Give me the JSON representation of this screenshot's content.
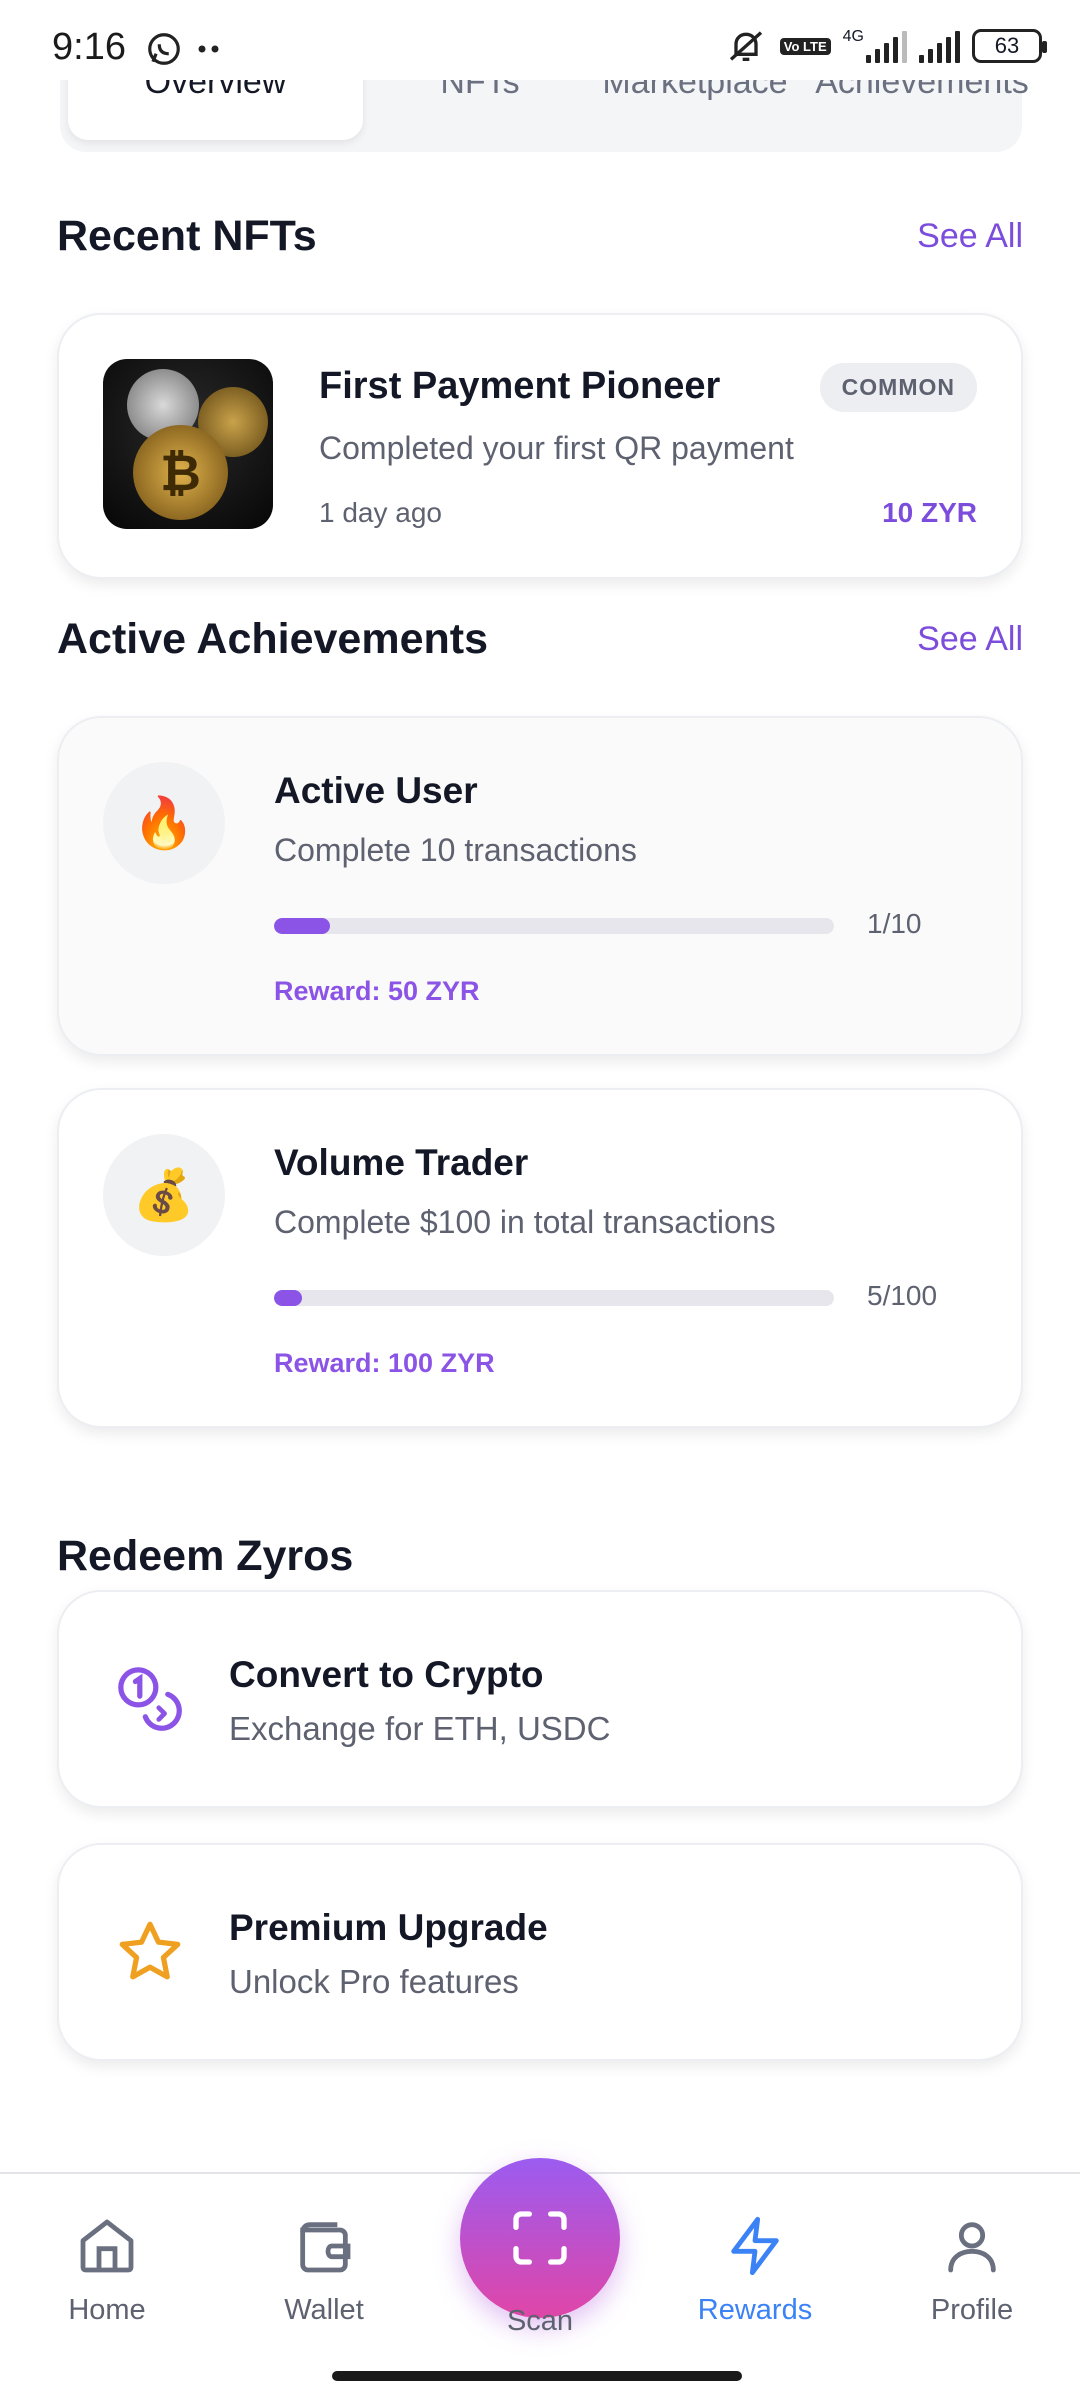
{
  "status_bar": {
    "time": "9:16",
    "network": "4G",
    "lte_label": "Vo LTE",
    "battery": "63"
  },
  "tabs": [
    {
      "label": "Overview",
      "active": true
    },
    {
      "label": "NFTs",
      "active": false
    },
    {
      "label": "Marketplace",
      "active": false
    },
    {
      "label": "Achievements",
      "active": false
    }
  ],
  "recent_nfts": {
    "title": "Recent NFTs",
    "see_all": "See All",
    "items": [
      {
        "name": "First Payment Pioneer",
        "description": "Completed your first QR payment",
        "time": "1 day ago",
        "rarity": "COMMON",
        "value": "10 ZYR"
      }
    ]
  },
  "active_achievements": {
    "title": "Active Achievements",
    "see_all": "See All",
    "items": [
      {
        "icon": "fire-icon",
        "emoji": "🔥",
        "title": "Active User",
        "description": "Complete 10 transactions",
        "progress_text": "1/10",
        "progress": 0.1,
        "reward": "Reward: 50 ZYR"
      },
      {
        "icon": "money-bag-icon",
        "emoji": "💰",
        "title": "Volume Trader",
        "description": "Complete $100 in total transactions",
        "progress_text": "5/100",
        "progress": 0.05,
        "reward": "Reward: 100 ZYR"
      }
    ]
  },
  "redeem": {
    "title": "Redeem Zyros",
    "items": [
      {
        "icon": "coins-exchange-icon",
        "title": "Convert to Crypto",
        "description": "Exchange for ETH, USDC"
      },
      {
        "icon": "star-icon",
        "title": "Premium Upgrade",
        "description": "Unlock Pro features"
      }
    ]
  },
  "bottom_nav": {
    "items": [
      {
        "label": "Home",
        "icon": "home-icon",
        "active": false
      },
      {
        "label": "Wallet",
        "icon": "wallet-icon",
        "active": false
      },
      {
        "label": "Scan",
        "icon": "scan-icon",
        "active": false
      },
      {
        "label": "Rewards",
        "icon": "lightning-icon",
        "active": true
      },
      {
        "label": "Profile",
        "icon": "user-icon",
        "active": false
      }
    ]
  },
  "colors": {
    "accent_purple": "#7c4ddc",
    "active_nav_blue": "#3b82f6",
    "scan_gradient_top": "#9b5cf0",
    "scan_gradient_bottom": "#e046a8",
    "star_orange": "#f0a020"
  }
}
